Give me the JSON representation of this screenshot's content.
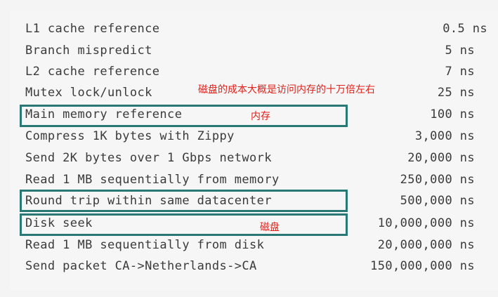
{
  "latency_table": {
    "rows": [
      {
        "operation": "L1 cache reference",
        "latency": "0.5 ns"
      },
      {
        "operation": "Branch mispredict",
        "latency": "5 ns"
      },
      {
        "operation": "L2 cache reference",
        "latency": "7 ns"
      },
      {
        "operation": "Mutex lock/unlock",
        "latency": "25 ns"
      },
      {
        "operation": "Main memory reference",
        "latency": "100 ns"
      },
      {
        "operation": "Compress 1K bytes with Zippy",
        "latency": "3,000 ns"
      },
      {
        "operation": "Send 2K bytes over 1 Gbps network",
        "latency": "20,000 ns"
      },
      {
        "operation": "Read 1 MB sequentially from memory",
        "latency": "250,000 ns"
      },
      {
        "operation": "Round trip within same datacenter",
        "latency": "500,000 ns"
      },
      {
        "operation": "Disk seek",
        "latency": "10,000,000 ns"
      },
      {
        "operation": "Read 1 MB sequentially from disk",
        "latency": "20,000,000 ns"
      },
      {
        "operation": "Send packet CA->Netherlands->CA",
        "latency": "150,000,000 ns"
      }
    ]
  },
  "annotations": {
    "summary": "磁盘的成本大概是访问内存的十万倍左右",
    "memory_label": "内存",
    "disk_label": "磁盘",
    "highlight_color": "#2a7876",
    "note_color": "#e0201a"
  }
}
